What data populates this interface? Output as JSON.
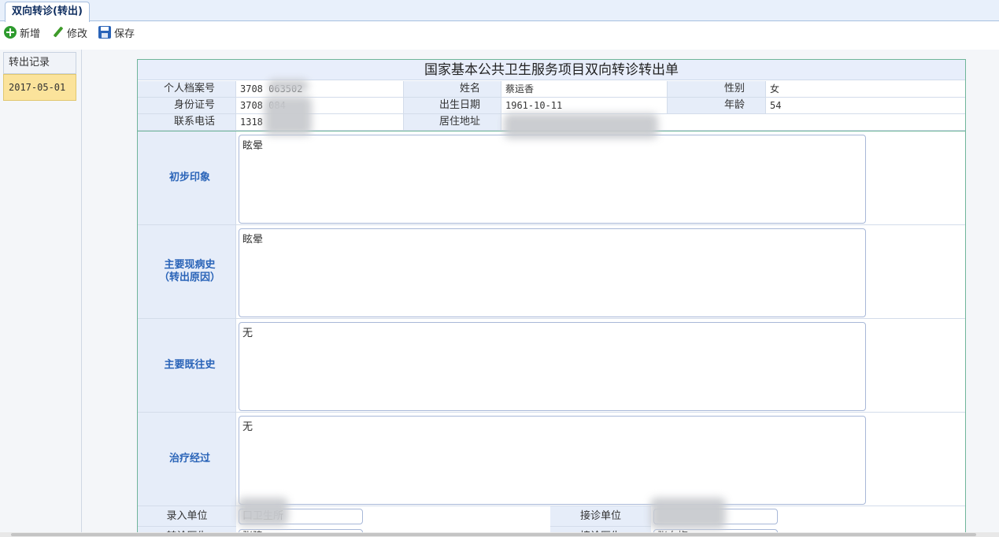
{
  "tab": {
    "title": "双向转诊(转出)"
  },
  "toolbar": {
    "add_label": "新增",
    "edit_label": "修改",
    "save_label": "保存"
  },
  "records": {
    "header": "转出记录",
    "items": [
      "2017-05-01"
    ]
  },
  "form": {
    "title": "国家基本公共卫生服务项目双向转诊转出单",
    "file_no_label": "个人档案号",
    "file_no_value": "3708      063502",
    "name_label": "姓名",
    "name_value": "蔡运香",
    "gender_label": "性别",
    "gender_value": "女",
    "id_label": "身份证号",
    "id_value": "3708        084",
    "birth_label": "出生日期",
    "birth_value": "1961-10-11",
    "age_label": "年龄",
    "age_value": "54",
    "phone_label": "联系电话",
    "phone_value": "1318",
    "address_label": "居住地址",
    "address_value": "",
    "sections": {
      "impression_label": "初步印象",
      "impression_value": "眩晕",
      "history_label_line1": "主要现病史",
      "history_label_line2": "（转出原因）",
      "history_value": "眩晕",
      "past_label": "主要既往史",
      "past_value": "无",
      "treatment_label": "治疗经过",
      "treatment_value": "无"
    },
    "entry_unit_label": "录入单位",
    "entry_unit_value": "口卫生所",
    "receive_unit_label": "接诊单位",
    "receive_unit_value": "",
    "doctor_label": "转诊医生",
    "doctor_value": "张建",
    "receive_doctor_label": "接诊医生",
    "receive_doctor_value": "张向梅"
  }
}
